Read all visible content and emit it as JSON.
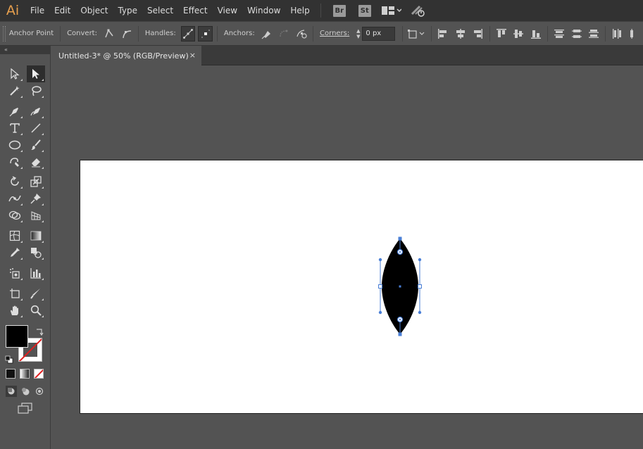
{
  "app": {
    "logo": "Ai"
  },
  "menu": [
    "File",
    "Edit",
    "Object",
    "Type",
    "Select",
    "Effect",
    "View",
    "Window",
    "Help"
  ],
  "app_buttons": {
    "bridge": "Br",
    "stock": "St"
  },
  "controlbar": {
    "mode_label": "Anchor Point",
    "convert_label": "Convert:",
    "handles_label": "Handles:",
    "anchors_label": "Anchors:",
    "corners_label": "Corners:",
    "corners_value": "0 px"
  },
  "document": {
    "tab_title": "Untitled-3* @ 50% (RGB/Preview)",
    "tab_close": "×"
  },
  "tools_header": "«",
  "colors": {
    "fill": "#000000",
    "stroke": "none",
    "selection": "#4a7fd6",
    "ui_dark": "#323232",
    "ui_mid": "#535353"
  }
}
